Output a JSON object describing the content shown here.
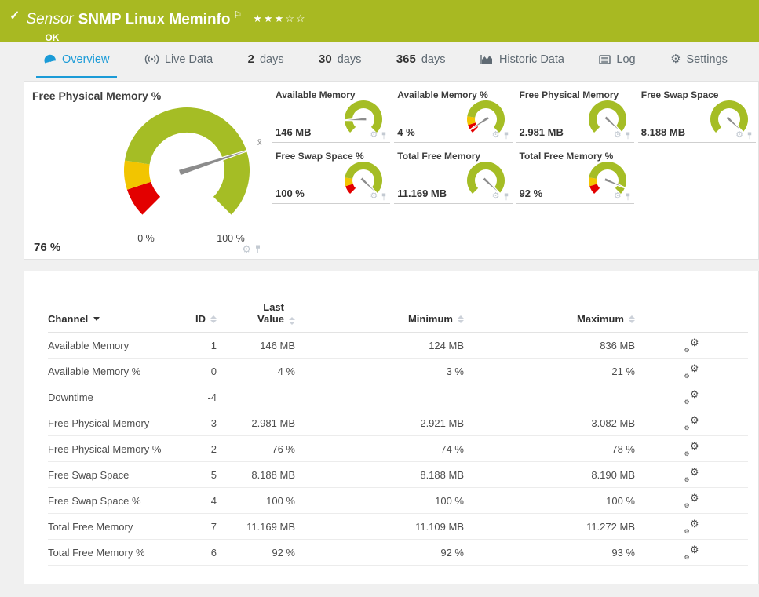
{
  "colors": {
    "brand_green": "#a8b922",
    "accent_blue": "#1b9bd7",
    "gauge_green": "#a5bd25",
    "gauge_yellow": "#f2c500",
    "gauge_red": "#e30000",
    "needle_gray": "#8c8c8c"
  },
  "icons": {
    "gear": "⚙"
  },
  "header": {
    "status_icon": "✓",
    "kind": "Sensor",
    "title": "SNMP Linux Meminfo",
    "flag_icon": "⚐",
    "rating": "★★★☆☆",
    "status": "OK"
  },
  "tabs": [
    {
      "label": "Overview"
    },
    {
      "label": "Live Data"
    },
    {
      "num": "2",
      "unit": "days"
    },
    {
      "num": "30",
      "unit": "days"
    },
    {
      "num": "365",
      "unit": "days"
    },
    {
      "label": "Historic Data"
    },
    {
      "label": "Log"
    },
    {
      "label": "Settings"
    }
  ],
  "gauges": {
    "main": {
      "title": "Free Physical Memory %",
      "value": "76 %",
      "min_label": "0 %",
      "max_label": "100 %",
      "needle_deg": 72,
      "avg_marker": "x̄"
    },
    "small": [
      {
        "title": "Available Memory",
        "value": "146 MB",
        "needle_deg": -93
      },
      {
        "title": "Available Memory %",
        "value": "4 %",
        "needle_deg": -124
      },
      {
        "title": "Free Physical Memory",
        "value": "2.981 MB",
        "needle_deg": 133
      },
      {
        "title": "Free Swap Space",
        "value": "8.188 MB",
        "needle_deg": 133
      },
      {
        "title": "Free Swap Space %",
        "value": "100 %",
        "needle_deg": 134
      },
      {
        "title": "Total Free Memory",
        "value": "11.169 MB",
        "needle_deg": 133
      },
      {
        "title": "Total Free Memory %",
        "value": "92 %",
        "needle_deg": 113
      }
    ]
  },
  "table": {
    "columns": [
      "Channel",
      "ID",
      "Last Value",
      "Minimum",
      "Maximum"
    ],
    "rows": [
      {
        "channel": "Available Memory",
        "id": "1",
        "last": "146 MB",
        "min": "124 MB",
        "max": "836 MB"
      },
      {
        "channel": "Available Memory %",
        "id": "0",
        "last": "4 %",
        "min": "3 %",
        "max": "21 %"
      },
      {
        "channel": "Downtime",
        "id": "-4",
        "last": "",
        "min": "",
        "max": ""
      },
      {
        "channel": "Free Physical Memory",
        "id": "3",
        "last": "2.981 MB",
        "min": "2.921 MB",
        "max": "3.082 MB"
      },
      {
        "channel": "Free Physical Memory %",
        "id": "2",
        "last": "76 %",
        "min": "74 %",
        "max": "78 %"
      },
      {
        "channel": "Free Swap Space",
        "id": "5",
        "last": "8.188 MB",
        "min": "8.188 MB",
        "max": "8.190 MB"
      },
      {
        "channel": "Free Swap Space %",
        "id": "4",
        "last": "100 %",
        "min": "100 %",
        "max": "100 %"
      },
      {
        "channel": "Total Free Memory",
        "id": "7",
        "last": "11.169 MB",
        "min": "11.109 MB",
        "max": "11.272 MB"
      },
      {
        "channel": "Total Free Memory %",
        "id": "6",
        "last": "92 %",
        "min": "92 %",
        "max": "93 %"
      }
    ]
  }
}
